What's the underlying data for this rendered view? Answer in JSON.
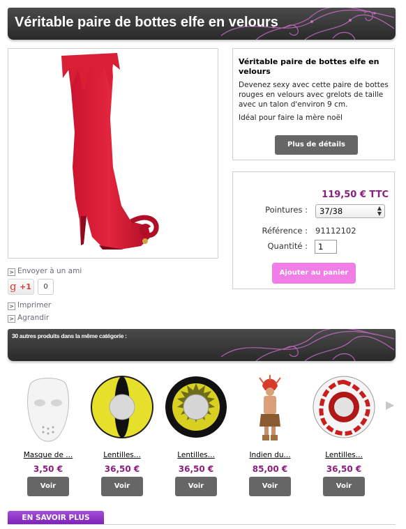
{
  "header": {
    "title": "Véritable paire de bottes elfe en velours"
  },
  "description": {
    "title": "Véritable paire de bottes elfe en velours",
    "text": "Devenez  sexy avec cette paire de bottes rouges en velours avec grelots de taille avec un talon d'environ 9 cm.",
    "text2": "Idéal pour faire la mère noël",
    "details_button": "Plus de détails"
  },
  "purchase": {
    "price": "119,50 € TTC",
    "size_label": "Pointures :",
    "size_value": "37/38",
    "reference_label": "Référence :",
    "reference_value": "91112102",
    "quantity_label": "Quantité :",
    "quantity_value": "1",
    "add_to_cart": "Ajouter au panier"
  },
  "actions": {
    "send_friend": "Envoyer à un ami",
    "gplus_label": "+1",
    "gplus_count": "0",
    "print": "Imprimer",
    "enlarge": "Agrandir"
  },
  "related": {
    "title": "30 autres produits dans la même catégorie :",
    "view_label": "Voir",
    "items": [
      {
        "name": "Masque de ...",
        "price": "3,50 €",
        "icon": "white-mask"
      },
      {
        "name": "Lentilles...",
        "price": "36,50 €",
        "icon": "yellow-cat-eye-lens"
      },
      {
        "name": "Lentilles...",
        "price": "36,50 €",
        "icon": "yellow-black-lens"
      },
      {
        "name": "Indien du...",
        "price": "85,00 €",
        "icon": "indian-costume"
      },
      {
        "name": "Lentilles...",
        "price": "36,50 €",
        "icon": "blood-lens"
      }
    ]
  },
  "footer": {
    "tab_label": "EN SAVOIR PLUS"
  },
  "colors": {
    "price": "#8b1e7e",
    "cart_button": "#f07ee6",
    "header_bg": "#333333",
    "tab": "#8a2fc4"
  }
}
